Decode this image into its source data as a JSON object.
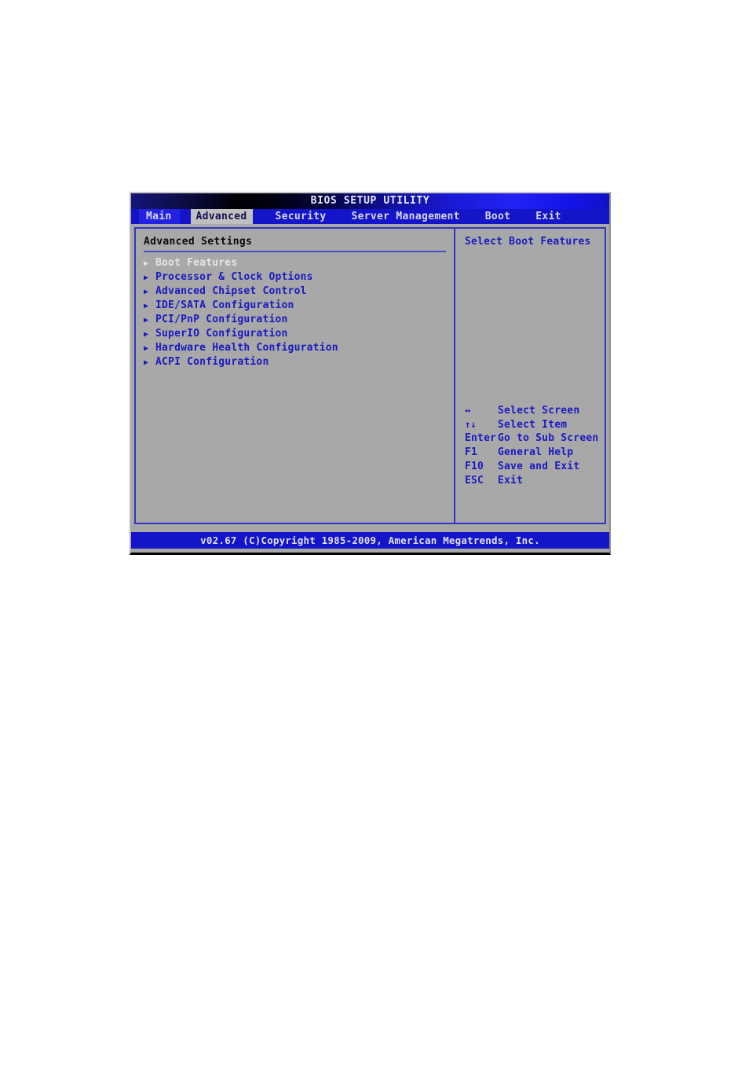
{
  "title_bar": {
    "title": "BIOS SETUP UTILITY"
  },
  "menu_bar": {
    "tabs": [
      {
        "label": "Main",
        "active": false
      },
      {
        "label": "Advanced",
        "active": true
      },
      {
        "label": "Security",
        "active": false
      },
      {
        "label": "Server Management",
        "active": false
      },
      {
        "label": "Boot",
        "active": false
      },
      {
        "label": "Exit",
        "active": false
      }
    ]
  },
  "left_panel": {
    "section_title": "Advanced Settings",
    "items": [
      {
        "label": "Boot Features",
        "marker": "▶",
        "selected": true
      },
      {
        "label": "Processor & Clock Options",
        "marker": "▶",
        "selected": false
      },
      {
        "label": "Advanced Chipset Control",
        "marker": "▶",
        "selected": false
      },
      {
        "label": "IDE/SATA Configuration",
        "marker": "▶",
        "selected": false
      },
      {
        "label": "PCI/PnP Configuration",
        "marker": "▶",
        "selected": false
      },
      {
        "label": "SuperIO Configuration",
        "marker": "▶",
        "selected": false
      },
      {
        "label": "Hardware Health Configuration",
        "marker": "▶",
        "selected": false
      },
      {
        "label": "ACPI Configuration",
        "marker": "▶",
        "selected": false
      }
    ]
  },
  "right_panel": {
    "help_text": "Select Boot Features",
    "legend": [
      {
        "key": "↔",
        "action": "Select Screen"
      },
      {
        "key": "↑↓",
        "action": "Select Item"
      },
      {
        "key": "Enter",
        "action": "Go to Sub Screen"
      },
      {
        "key": "F1",
        "action": "General Help"
      },
      {
        "key": "F10",
        "action": "Save and Exit"
      },
      {
        "key": "ESC",
        "action": "Exit"
      }
    ]
  },
  "footer": {
    "text": "v02.67 (C)Copyright 1985-2009, American Megatrends, Inc."
  },
  "colors": {
    "screen_background": "#a8a8a8",
    "bar_blue": "#1414c8",
    "frame_blue": "#3434c4",
    "text_blue": "#1a1ac0",
    "selected_item": "#e4e4e4",
    "active_tab_bg": "#c0c0c0",
    "active_tab_text": "#101050",
    "title_text": "#e8e8f8"
  }
}
